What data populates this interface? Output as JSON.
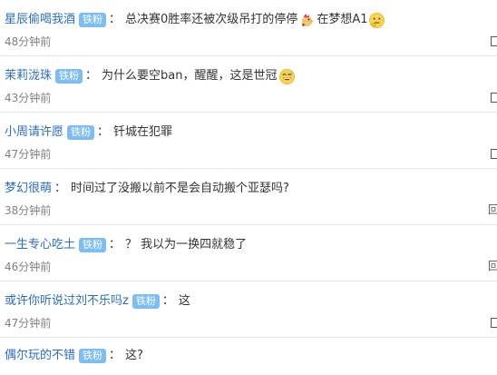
{
  "badge_label": "铁粉",
  "colors": {
    "username": "#2d6db6",
    "badge_bg": "#7fbcf0",
    "time": "#808080",
    "divider": "#e8e8e8"
  },
  "comments": [
    {
      "username": "星辰偷喝我酒",
      "colon": "：",
      "text_before": "总决赛0胜率还被次级吊打的停停",
      "emoji_1": "chicken-emoji",
      "text_middle": "在梦想A1",
      "emoji_2": "thinking-face-emoji",
      "time": "48分钟前",
      "reply_label": "回"
    },
    {
      "username": "茉莉泷珠",
      "colon": "：",
      "text_before": "为什么要空ban，醒醒，这是世冠",
      "emoji_1": "grinning-sweat-emoji",
      "time": "43分钟前",
      "reply_label": "回"
    },
    {
      "username": "小周请许愿",
      "colon": "：",
      "text_before": "钎城在犯罪",
      "time": "47分钟前",
      "reply_label": "回"
    },
    {
      "username": "梦幻很萌",
      "colon": "：",
      "text_before": "时间过了没搬以前不是会自动搬个亚瑟吗?",
      "time": "38分钟前",
      "reply_label": "回"
    },
    {
      "username": "一生专心吃土",
      "colon": "：",
      "text_before": "？ 我以为一换四就稳了",
      "time": "46分钟前",
      "reply_label": "回"
    },
    {
      "username": "或许你听说过刘不乐吗z",
      "colon": "：",
      "text_before": "这",
      "time": "47分钟前",
      "reply_label": "回"
    },
    {
      "username": "偶尔玩的不错",
      "colon": "：",
      "text_before": "这?",
      "time": "",
      "reply_label": ""
    }
  ]
}
